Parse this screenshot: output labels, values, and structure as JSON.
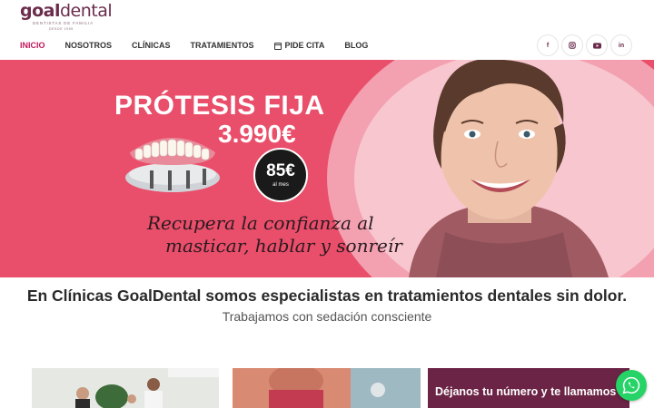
{
  "logo": {
    "brand_bold": "goal",
    "brand_light": "dental",
    "tagline": "DENTISTAS DE FAMILIA",
    "since": "DESDE 1995"
  },
  "nav": {
    "items": [
      {
        "label": "INICIO",
        "active": true
      },
      {
        "label": "NOSOTROS"
      },
      {
        "label": "CLÍNICAS"
      },
      {
        "label": "TRATAMIENTOS"
      },
      {
        "label": "PIDE CITA",
        "icon": "calendar-icon"
      },
      {
        "label": "BLOG"
      }
    ]
  },
  "socials": [
    {
      "icon": "facebook-icon",
      "glyph": "f"
    },
    {
      "icon": "instagram-icon",
      "glyph": "◙"
    },
    {
      "icon": "youtube-icon",
      "glyph": "▶"
    },
    {
      "icon": "linkedin-icon",
      "glyph": "in"
    }
  ],
  "banner": {
    "title": "PRÓTESIS FIJA",
    "price": "3.990€",
    "monthly_price": "85€",
    "monthly_label": "al mes",
    "tagline_line1": "Recupera la confianza al",
    "tagline_line2": "masticar, hablar y sonreír"
  },
  "intro": {
    "headline": "En Clínicas GoalDental somos especialistas en tratamientos dentales sin dolor.",
    "subline": "Trabajamos con sedación consciente"
  },
  "cards": {
    "callback_title": "Déjanos tu número y te llamamos"
  },
  "colors": {
    "brand": "#6b2c4c",
    "active_nav": "#c2185b",
    "banner_bg": "#e94e6a",
    "whatsapp": "#25d366"
  }
}
